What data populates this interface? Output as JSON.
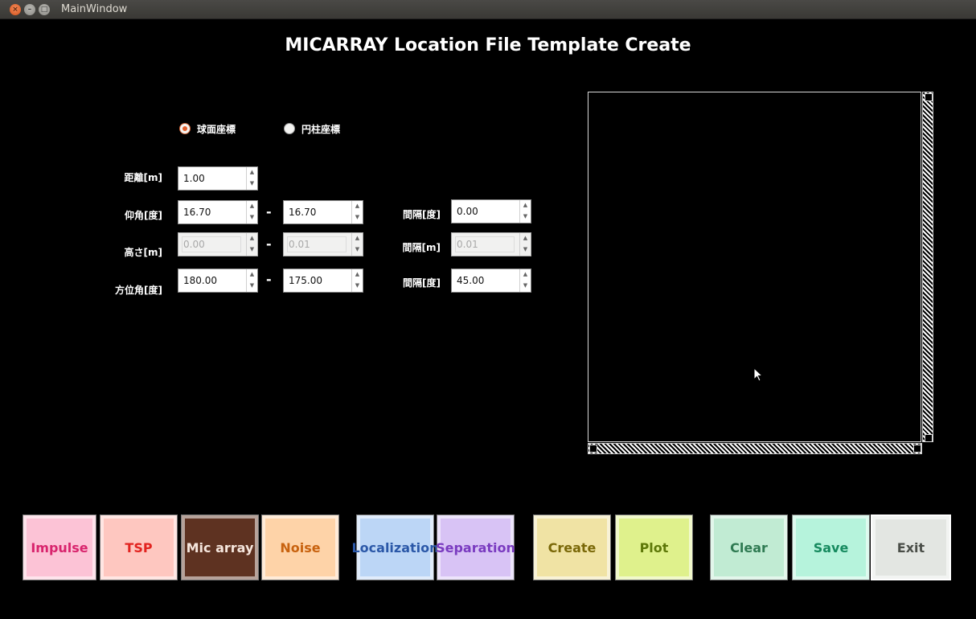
{
  "window": {
    "title": "MainWindow",
    "close_glyph": "×",
    "min_glyph": "–",
    "max_glyph": "□"
  },
  "app_title": "MICARRAY Location File Template Create",
  "coords": {
    "spherical": "球面座標",
    "cylindrical": "円柱座標",
    "selected": "spherical"
  },
  "labels": {
    "distance": "距離[m]",
    "elevation": "仰角[度]",
    "height": "高さ[m]",
    "azimuth": "方位角[度]",
    "interval_deg_1": "間隔[度]",
    "interval_m": "間隔[m]",
    "interval_deg_2": "間隔[度]",
    "dash": "-"
  },
  "fields": {
    "distance": "1.00",
    "elevation_from": "16.70",
    "elevation_to": "16.70",
    "elevation_step": "0.00",
    "height_from": "0.00",
    "height_to": "0.01",
    "height_step": "0.01",
    "azimuth_from": "180.00",
    "azimuth_to": "175.00",
    "azimuth_step": "45.00"
  },
  "spin_up": "▲",
  "spin_down": "▼",
  "buttons": [
    {
      "key": "impulse",
      "label": "Impulse",
      "bg": "#fcc3d6",
      "fg": "#d8246d"
    },
    {
      "key": "tsp",
      "label": "TSP",
      "bg": "#fec7c0",
      "fg": "#e2231f"
    },
    {
      "key": "micarray",
      "label": "Mic array",
      "bg": "#5e3221",
      "fg": "#f6e6dd"
    },
    {
      "key": "noise",
      "label": "Noise",
      "bg": "#fed3a8",
      "fg": "#c8620f"
    },
    {
      "key": "localization",
      "label": "Localization",
      "bg": "#bcd6f6",
      "fg": "#2b58a8"
    },
    {
      "key": "separation",
      "label": "Separation",
      "bg": "#d8c3f5",
      "fg": "#7a3bc0"
    },
    {
      "key": "create",
      "label": "Create",
      "bg": "#f0e3a4",
      "fg": "#7a6808"
    },
    {
      "key": "plot",
      "label": "Plot",
      "bg": "#dff18c",
      "fg": "#5d7808"
    },
    {
      "key": "clear",
      "label": "Clear",
      "bg": "#c1ebd3",
      "fg": "#2f7a52"
    },
    {
      "key": "save",
      "label": "Save",
      "bg": "#b6f3dc",
      "fg": "#168a5f"
    },
    {
      "key": "exit",
      "label": "Exit",
      "bg": "#e3e6e2",
      "fg": "#4a4e48"
    }
  ]
}
